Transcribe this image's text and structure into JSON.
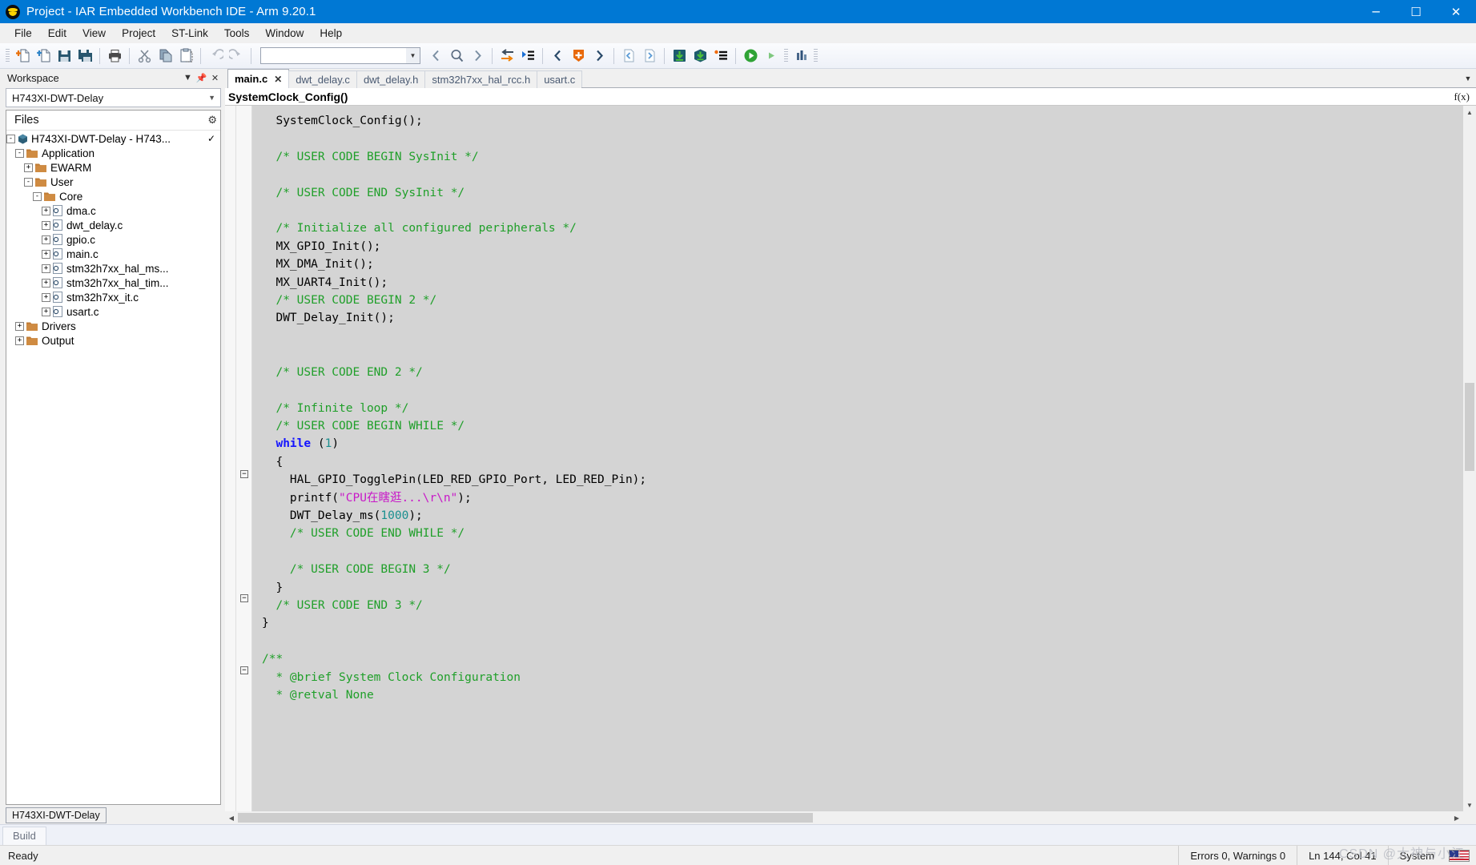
{
  "titlebar": {
    "title": "Project - IAR Embedded Workbench IDE - Arm 9.20.1",
    "minimize": "─",
    "maximize": "☐",
    "close": "✕",
    "app_icon": "iar-logo-icon"
  },
  "menubar": {
    "items": [
      {
        "label": "File"
      },
      {
        "label": "Edit"
      },
      {
        "label": "View"
      },
      {
        "label": "Project"
      },
      {
        "label": "ST-Link"
      },
      {
        "label": "Tools"
      },
      {
        "label": "Window"
      },
      {
        "label": "Help"
      }
    ]
  },
  "toolbar": {
    "combo_value": "",
    "buttons": [
      {
        "name": "new-document-icon"
      },
      {
        "name": "open-document-icon"
      },
      {
        "name": "save-icon"
      },
      {
        "name": "save-all-icon"
      },
      {
        "name": "print-icon"
      },
      {
        "name": "cut-icon"
      },
      {
        "name": "copy-icon"
      },
      {
        "name": "paste-icon"
      },
      {
        "name": "undo-icon"
      },
      {
        "name": "redo-icon"
      },
      {
        "name": "search-previous-icon"
      },
      {
        "name": "find-icon"
      },
      {
        "name": "search-next-icon"
      },
      {
        "name": "go-to-icon"
      },
      {
        "name": "toggle-bookmark-icon"
      },
      {
        "name": "navigate-backward-icon"
      },
      {
        "name": "compile-icon"
      },
      {
        "name": "navigate-forward-icon"
      },
      {
        "name": "previous-file-icon"
      },
      {
        "name": "next-file-icon"
      },
      {
        "name": "download-and-debug-icon"
      },
      {
        "name": "download-active-icon"
      },
      {
        "name": "make-icon"
      },
      {
        "name": "run-icon"
      },
      {
        "name": "start-debug-icon"
      },
      {
        "name": "stop-debug-icon"
      },
      {
        "name": "chart-icon"
      }
    ]
  },
  "workspace": {
    "title": "Workspace",
    "dropdown_icon": "chevron-down-icon",
    "close_icon": "close-icon",
    "pin_icon": "pin-icon",
    "config_value": "H743XI-DWT-Delay",
    "files_header": "Files",
    "gear_icon": "gear-icon",
    "footer_tab": "H743XI-DWT-Delay",
    "tree": [
      {
        "label": "H743XI-DWT-Delay - H743...",
        "indent": 0,
        "toggle": "-",
        "icon": "project-icon",
        "checked": "✓"
      },
      {
        "label": "Application",
        "indent": 1,
        "toggle": "-",
        "icon": "folder-icon",
        "checked": ""
      },
      {
        "label": "EWARM",
        "indent": 2,
        "toggle": "+",
        "icon": "folder-icon",
        "checked": ""
      },
      {
        "label": "User",
        "indent": 2,
        "toggle": "-",
        "icon": "folder-icon",
        "checked": ""
      },
      {
        "label": "Core",
        "indent": 3,
        "toggle": "-",
        "icon": "folder-icon",
        "checked": ""
      },
      {
        "label": "dma.c",
        "indent": 4,
        "toggle": "+",
        "icon": "c-file-icon",
        "checked": ""
      },
      {
        "label": "dwt_delay.c",
        "indent": 4,
        "toggle": "+",
        "icon": "c-file-icon",
        "checked": ""
      },
      {
        "label": "gpio.c",
        "indent": 4,
        "toggle": "+",
        "icon": "c-file-icon",
        "checked": ""
      },
      {
        "label": "main.c",
        "indent": 4,
        "toggle": "+",
        "icon": "c-file-icon",
        "checked": ""
      },
      {
        "label": "stm32h7xx_hal_ms...",
        "indent": 4,
        "toggle": "+",
        "icon": "c-file-icon",
        "checked": ""
      },
      {
        "label": "stm32h7xx_hal_tim...",
        "indent": 4,
        "toggle": "+",
        "icon": "c-file-icon",
        "checked": ""
      },
      {
        "label": "stm32h7xx_it.c",
        "indent": 4,
        "toggle": "+",
        "icon": "c-file-icon",
        "checked": ""
      },
      {
        "label": "usart.c",
        "indent": 4,
        "toggle": "+",
        "icon": "c-file-icon",
        "checked": ""
      },
      {
        "label": "Drivers",
        "indent": 1,
        "toggle": "+",
        "icon": "folder-icon",
        "checked": ""
      },
      {
        "label": "Output",
        "indent": 1,
        "toggle": "+",
        "icon": "folder-icon",
        "checked": ""
      }
    ]
  },
  "editor": {
    "tabs": [
      {
        "label": "main.c",
        "active": true,
        "close": "✕"
      },
      {
        "label": "dwt_delay.c",
        "active": false
      },
      {
        "label": "dwt_delay.h",
        "active": false
      },
      {
        "label": "stm32h7xx_hal_rcc.h",
        "active": false
      },
      {
        "label": "usart.c",
        "active": false
      }
    ],
    "tabbar_overflow_icon": "chevron-down-icon",
    "function_bar": "SystemClock_Config()",
    "function_icon": "f(x)",
    "code_lines": [
      {
        "text": "  SystemClock_Config();",
        "type": "plain"
      },
      {
        "text": "",
        "type": "plain"
      },
      {
        "text": "  /* USER CODE BEGIN SysInit */",
        "type": "comment"
      },
      {
        "text": "",
        "type": "plain"
      },
      {
        "text": "  /* USER CODE END SysInit */",
        "type": "comment"
      },
      {
        "text": "",
        "type": "plain"
      },
      {
        "text": "  /* Initialize all configured peripherals */",
        "type": "comment"
      },
      {
        "text": "  MX_GPIO_Init();",
        "type": "plain"
      },
      {
        "text": "  MX_DMA_Init();",
        "type": "plain"
      },
      {
        "text": "  MX_UART4_Init();",
        "type": "plain"
      },
      {
        "text": "  /* USER CODE BEGIN 2 */",
        "type": "comment"
      },
      {
        "text": "  DWT_Delay_Init();",
        "type": "plain"
      },
      {
        "text": "",
        "type": "plain"
      },
      {
        "text": "",
        "type": "plain"
      },
      {
        "text": "  /* USER CODE END 2 */",
        "type": "comment"
      },
      {
        "text": "",
        "type": "plain"
      },
      {
        "text": "  /* Infinite loop */",
        "type": "comment"
      },
      {
        "text": "  /* USER CODE BEGIN WHILE */",
        "type": "comment"
      },
      {
        "text": "  while (1)",
        "type": "while"
      },
      {
        "text": "  {",
        "type": "plain"
      },
      {
        "text": "    HAL_GPIO_TogglePin(LED_RED_GPIO_Port, LED_RED_Pin);",
        "type": "plain"
      },
      {
        "text": "    printf(\"CPU在瞎逛...\\r\\n\");",
        "type": "printf"
      },
      {
        "text": "    DWT_Delay_ms(1000);",
        "type": "delay"
      },
      {
        "text": "    /* USER CODE END WHILE */",
        "type": "comment"
      },
      {
        "text": "",
        "type": "plain"
      },
      {
        "text": "    /* USER CODE BEGIN 3 */",
        "type": "comment"
      },
      {
        "text": "  }",
        "type": "plain"
      },
      {
        "text": "  /* USER CODE END 3 */",
        "type": "comment"
      },
      {
        "text": "}",
        "type": "plain"
      },
      {
        "text": "",
        "type": "plain"
      },
      {
        "text": "/**",
        "type": "comment"
      },
      {
        "text": "  * @brief System Clock Configuration",
        "type": "comment"
      },
      {
        "text": "  * @retval None",
        "type": "comment"
      }
    ]
  },
  "bottom_panel": {
    "tabs": [
      {
        "label": "Build"
      }
    ]
  },
  "statusbar": {
    "ready": "Ready",
    "errors": "Errors 0, Warnings 0",
    "position": "Ln 144, Col 41",
    "encoding": "System",
    "flag_icon": "us-flag-icon"
  },
  "watermark": "CSDN @大神与小江",
  "colors": {
    "title_bar": "#0078d4",
    "comment": "#1f9f29",
    "keyword": "#1414ff",
    "string": "#c818c8",
    "number": "#1a8f8f",
    "editor_bg": "#d4d4d4"
  }
}
